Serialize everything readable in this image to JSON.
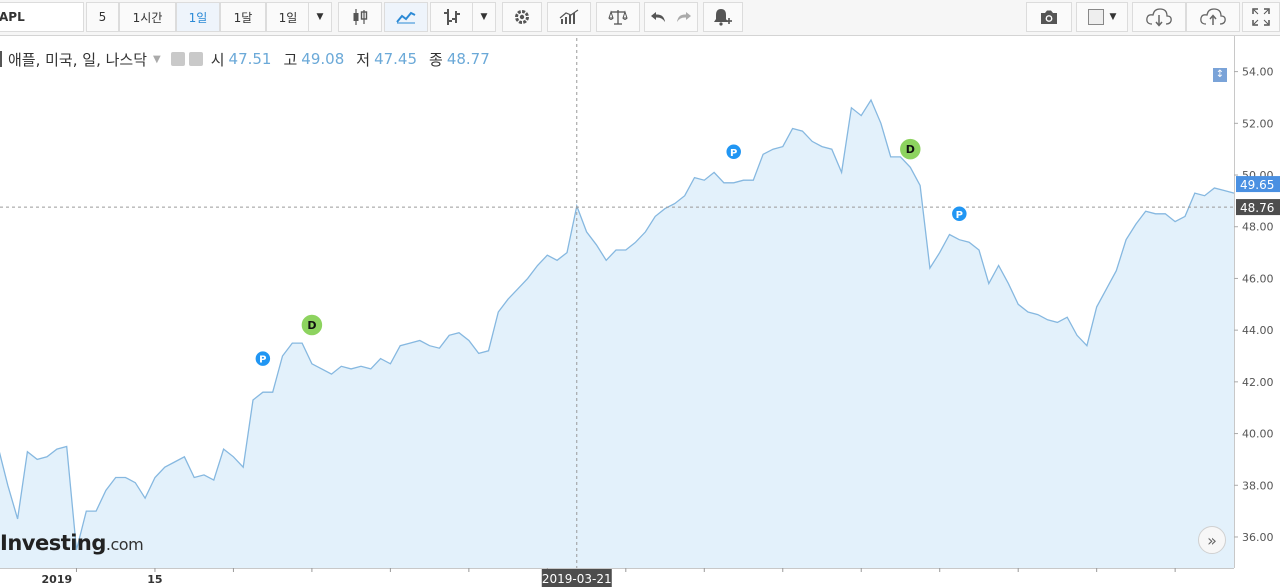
{
  "toolbar": {
    "symbol": "APL",
    "interval_minutes": "5",
    "interval_hour": "1시간",
    "interval_day": "1일",
    "interval_month": "1달",
    "period_selected": "1일"
  },
  "legend": {
    "title": "애플, 미국, 일, 나스닥",
    "open_label": "시",
    "open": "47.51",
    "high_label": "고",
    "high": "49.08",
    "low_label": "저",
    "low": "47.45",
    "close_label": "종",
    "close": "48.77"
  },
  "logo": {
    "brand": "Investing",
    "suffix": ".com"
  },
  "colors": {
    "line": "#86b8e0",
    "fill": "#e3f1fb",
    "last_price": "#4a90e2",
    "crosshair_price": "#4d4d4d",
    "dividend": "#8dd35f",
    "split": "#2196f3"
  },
  "chart_data": {
    "type": "area",
    "ylim": [
      34.8,
      55.3
    ],
    "y_ticks": [
      "36.00",
      "38.00",
      "40.00",
      "42.00",
      "44.00",
      "46.00",
      "48.00",
      "50.00",
      "52.00",
      "54.00"
    ],
    "x_labels": [
      {
        "i": 6,
        "text": "2019"
      },
      {
        "i": 16,
        "text": "15"
      },
      {
        "i": 59,
        "text": "2019-03-21"
      }
    ],
    "crosshair_index": 59,
    "crosshair_price": "48.76",
    "last_price": "49.65",
    "values": [
      39.5,
      38.0,
      36.7,
      39.3,
      39.0,
      39.1,
      39.4,
      39.5,
      35.5,
      37.0,
      37.0,
      37.8,
      38.3,
      38.3,
      38.1,
      37.5,
      38.3,
      38.7,
      38.9,
      39.1,
      38.3,
      38.4,
      38.2,
      39.4,
      39.1,
      38.7,
      41.3,
      41.6,
      41.6,
      43.0,
      43.5,
      43.5,
      42.7,
      42.5,
      42.3,
      42.6,
      42.5,
      42.6,
      42.5,
      42.9,
      42.7,
      43.4,
      43.5,
      43.6,
      43.4,
      43.3,
      43.8,
      43.9,
      43.6,
      43.1,
      43.2,
      44.7,
      45.2,
      45.6,
      46.0,
      46.5,
      46.9,
      46.7,
      47.0,
      48.8,
      47.8,
      47.3,
      46.7,
      47.1,
      47.1,
      47.4,
      47.8,
      48.4,
      48.7,
      48.9,
      49.2,
      49.9,
      49.8,
      50.1,
      49.7,
      49.7,
      49.8,
      49.8,
      50.8,
      51.0,
      51.1,
      51.8,
      51.7,
      51.3,
      51.1,
      51.0,
      50.1,
      52.6,
      52.3,
      52.9,
      52.0,
      50.7,
      50.7,
      50.3,
      49.6,
      46.4,
      47.0,
      47.7,
      47.5,
      47.4,
      47.1,
      45.8,
      46.5,
      45.8,
      45.0,
      44.7,
      44.6,
      44.4,
      44.3,
      44.5,
      43.8,
      43.4,
      44.9,
      45.6,
      46.3,
      47.5,
      48.1,
      48.6,
      48.5,
      48.5,
      48.2,
      48.4,
      49.3,
      49.2,
      49.5,
      49.4,
      49.3
    ],
    "events": [
      {
        "i": 27,
        "type": "P",
        "label": "P",
        "y": 42.9
      },
      {
        "i": 32,
        "type": "D",
        "label": "D",
        "y": 44.2
      },
      {
        "i": 75,
        "type": "P",
        "label": "P",
        "y": 50.9
      },
      {
        "i": 93,
        "type": "D",
        "label": "D",
        "y": 51.0
      },
      {
        "i": 98,
        "type": "P",
        "label": "P",
        "y": 48.5
      }
    ]
  }
}
